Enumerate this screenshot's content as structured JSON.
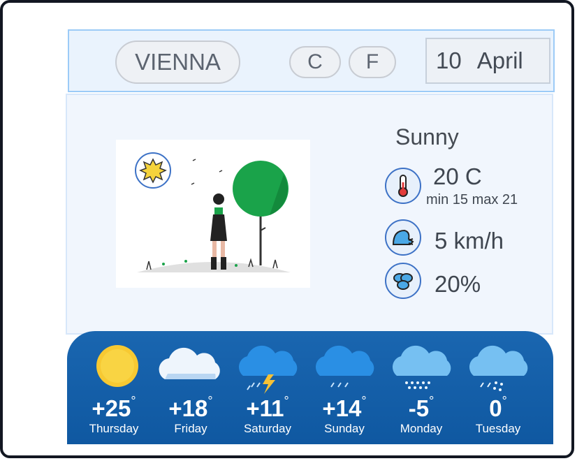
{
  "header": {
    "city": "VIENNA",
    "unit_c": "C",
    "unit_f": "F",
    "date_day": "10",
    "date_month": "April"
  },
  "current": {
    "condition": "Sunny",
    "temperature": "20 C",
    "range": "min 15 max 21",
    "wind": "5 km/h",
    "humidity": "20%"
  },
  "forecast": [
    {
      "temp": "+25",
      "day": "Thursday",
      "icon": "sun-icon"
    },
    {
      "temp": "+18",
      "day": "Friday",
      "icon": "cloud-icon"
    },
    {
      "temp": "+11",
      "day": "Saturday",
      "icon": "thunderstorm-icon"
    },
    {
      "temp": "+14",
      "day": "Sunday",
      "icon": "rain-icon"
    },
    {
      "temp": "-5",
      "day": "Monday",
      "icon": "snow-icon"
    },
    {
      "temp": "0",
      "day": "Tuesday",
      "icon": "sleet-icon"
    }
  ],
  "colors": {
    "accent": "#1a66b0",
    "frame": "#121722",
    "header_bg": "#eaf3fd"
  }
}
